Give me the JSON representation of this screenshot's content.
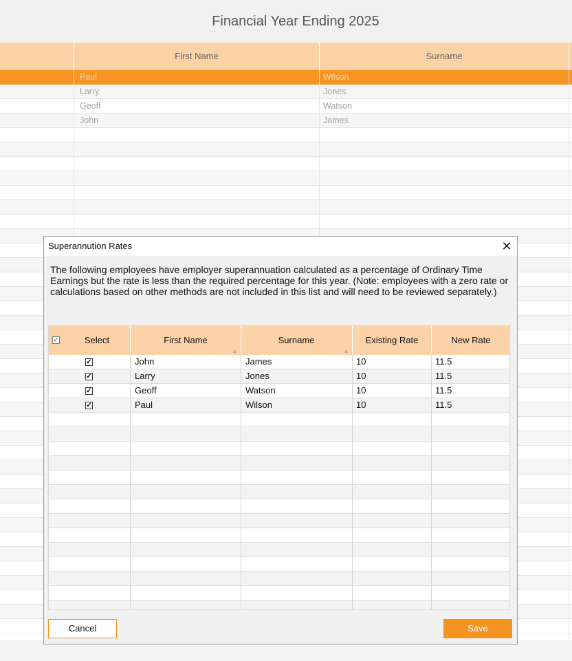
{
  "background": {
    "title": "Financial Year Ending 2025",
    "columns": {
      "first_name": "First Name",
      "surname": "Surname"
    },
    "rows": [
      {
        "first": "Paul",
        "last": "Wilson"
      },
      {
        "first": "Larry",
        "last": "Jones"
      },
      {
        "first": "Geoff",
        "last": "Watson"
      },
      {
        "first": "John",
        "last": "James"
      }
    ]
  },
  "dialog": {
    "title": "Superannution Rates",
    "message": "The following employees have employer superannuation calculated as a percentage of Ordinary Time Earnings but the rate is less than the required percentage for this year. (Note: employees with a zero rate or calculations based on other methods are not included in this list and will need to be reviewed separately.)",
    "columns": {
      "select": "Select",
      "first_name": "First Name",
      "surname": "Surname",
      "existing_rate": "Existing Rate",
      "new_rate": "New Rate"
    },
    "rows": [
      {
        "first": "John",
        "last": "James",
        "existing": "10",
        "new": "11.5"
      },
      {
        "first": "Larry",
        "last": "Jones",
        "existing": "10",
        "new": "11.5"
      },
      {
        "first": "Geoff",
        "last": "Watson",
        "existing": "10",
        "new": "11.5"
      },
      {
        "first": "Paul",
        "last": "Wilson",
        "existing": "10",
        "new": "11.5"
      }
    ],
    "cancel_label": "Cancel",
    "save_label": "Save"
  },
  "colors": {
    "accent": "#f89422",
    "header": "#fcd2a8"
  }
}
